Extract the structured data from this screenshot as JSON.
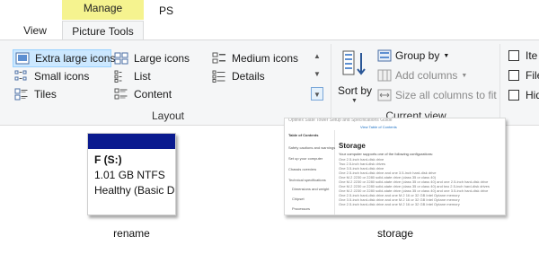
{
  "window": {
    "title": "PS"
  },
  "tabs": {
    "context_header": "Manage",
    "view": "View",
    "picture_tools": "Picture Tools"
  },
  "ribbon": {
    "layout": {
      "label": "Layout",
      "items": [
        {
          "label": "Extra large icons",
          "icon": "extra-large-icons-icon",
          "selected": true
        },
        {
          "label": "Large icons",
          "icon": "large-icons-icon"
        },
        {
          "label": "Medium icons",
          "icon": "medium-icons-icon"
        },
        {
          "label": "Small icons",
          "icon": "small-icons-icon"
        },
        {
          "label": "List",
          "icon": "list-icon"
        },
        {
          "label": "Details",
          "icon": "details-icon"
        },
        {
          "label": "Tiles",
          "icon": "tiles-icon"
        },
        {
          "label": "Content",
          "icon": "content-icon"
        }
      ]
    },
    "current_view": {
      "label": "Current view",
      "sort_by": "Sort by",
      "group_by": "Group by",
      "add_columns": "Add columns",
      "size_all_columns": "Size all columns to fit"
    },
    "show_hide": {
      "items": [
        "Ite",
        "File",
        "Hid"
      ]
    }
  },
  "files": [
    {
      "name": "rename",
      "thumbnail_lines": [
        "F (S:)",
        "1.01 GB NTFS",
        "Healthy (Basic D"
      ]
    },
    {
      "name": "storage",
      "thumbnail": {
        "header": "Optiflex Slate Tower Setup and Specifications Guide",
        "toc_link": "View Table of Contents",
        "toc_title": "Table of Contents",
        "heading": "Storage",
        "sidebar_items": [
          "Table of Contents",
          "Safety cautions and warnings",
          "Set up your computer",
          "Chassis overview",
          "Technical specifications",
          "Dimensions and weight",
          "Chipset",
          "Processors"
        ],
        "lines": [
          "Your computer supports one of the following configurations:",
          "One 2.5-inch hard-disk drive",
          "Two 2.5-inch hard-disk drives",
          "One 3.5-inch hard-disk drive",
          "One 2.5-inch hard-disk drive and one 3.5-inch hard-disk drive",
          "One M.2 2230 or 2280 solid-state drive (class 35 or class 40)",
          "One M.2 2230 or 2280 solid-state drive (class 35 or class 40) and one 2.5-inch hard-disk drive",
          "One M.2 2230 or 2280 solid-state drive (class 35 or class 40) and two 2.5-inch hard-disk drives",
          "One M.2 2230 or 2280 solid-state drive (class 35 or class 40) and one 3.5-inch hard-disk drive",
          "One 2.5-inch hard-disk drive and one M.2 16 or 32 GB Intel Optane memory",
          "One 3.5-inch hard-disk drive and one M.2 16 or 32 GB Intel Optane memory",
          "One 2.5-inch hard-disk drive and one M.2 16 or 32 GB Intel Optane memory"
        ]
      }
    }
  ],
  "colors": {
    "manage_band": "#f5f38f",
    "ribbon_bg": "#f5f6f7",
    "selection_bg": "#cce8ff",
    "drive_header": "#0a1a8f",
    "link_blue": "#1a6fc4"
  }
}
